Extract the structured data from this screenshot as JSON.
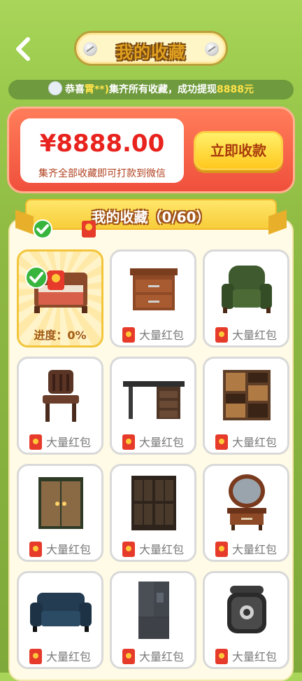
{
  "header": {
    "title": "我的收藏"
  },
  "ticker": {
    "prefix": "恭喜",
    "name": "霄**)",
    "middle": "集齐所有收藏，成功提现",
    "amount": "8888元"
  },
  "balance": {
    "amount": "¥8888.00",
    "subtitle": "集齐全部收藏即可打款到微信",
    "claim_label": "立即收款"
  },
  "collection": {
    "title": "我的收藏（0/60）",
    "items": [
      {
        "name": "bed",
        "caption": "进度：0%",
        "active": true
      },
      {
        "name": "nightstand",
        "caption": "大量红包"
      },
      {
        "name": "armchair",
        "caption": "大量红包"
      },
      {
        "name": "chair",
        "caption": "大量红包"
      },
      {
        "name": "desk",
        "caption": "大量红包"
      },
      {
        "name": "cabinet",
        "caption": "大量红包"
      },
      {
        "name": "wardrobe",
        "caption": "大量红包"
      },
      {
        "name": "bookcase",
        "caption": "大量红包"
      },
      {
        "name": "vanity",
        "caption": "大量红包"
      },
      {
        "name": "sofa",
        "caption": "大量红包"
      },
      {
        "name": "refrigerator",
        "caption": "大量红包"
      },
      {
        "name": "rice-cooker",
        "caption": "大量红包"
      }
    ]
  }
}
